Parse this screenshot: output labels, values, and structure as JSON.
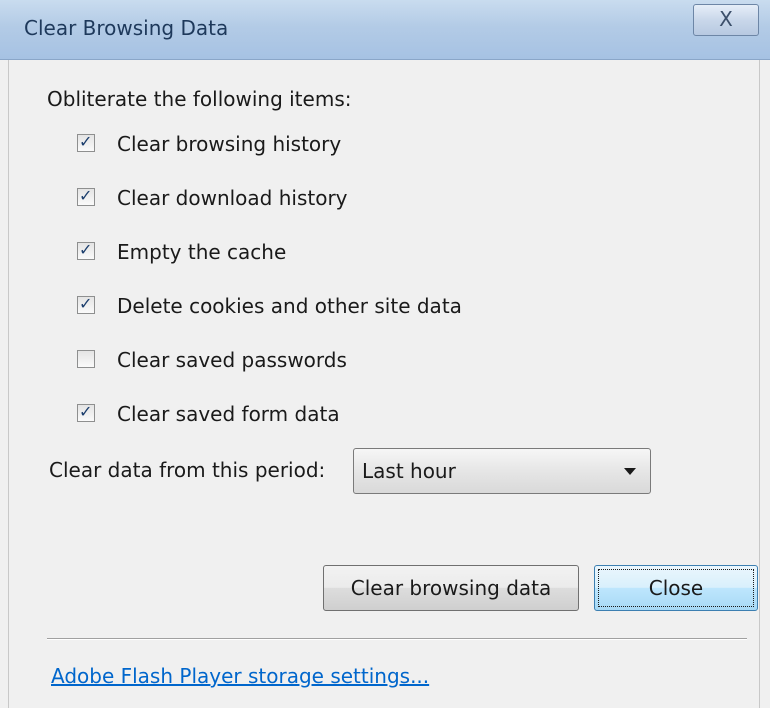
{
  "window": {
    "title": "Clear Browsing Data",
    "close_glyph": "X"
  },
  "heading": "Obliterate the following items:",
  "items": [
    {
      "label": "Clear browsing history",
      "checked": true
    },
    {
      "label": "Clear download history",
      "checked": true
    },
    {
      "label": "Empty the cache",
      "checked": true
    },
    {
      "label": "Delete cookies and other site data",
      "checked": true
    },
    {
      "label": "Clear saved passwords",
      "checked": false
    },
    {
      "label": "Clear saved form data",
      "checked": true
    }
  ],
  "period": {
    "label": "Clear data from this period:",
    "selected": "Last hour"
  },
  "buttons": {
    "clear": "Clear browsing data",
    "close": "Close"
  },
  "link": "Adobe Flash Player storage settings...",
  "icons": {
    "check": "check-icon",
    "dropdown": "chevron-down-icon",
    "close": "close-icon"
  }
}
